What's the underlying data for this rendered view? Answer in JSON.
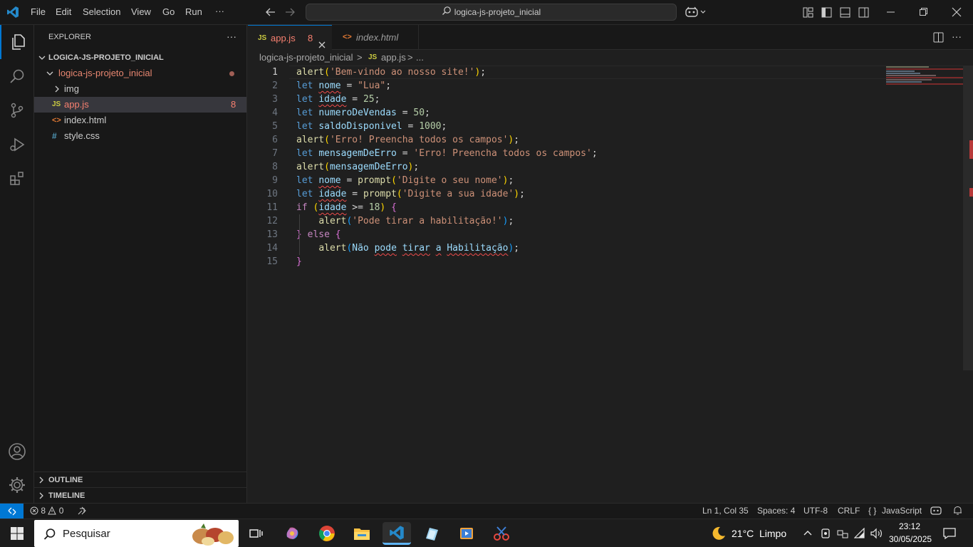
{
  "titlebar": {
    "menu": [
      "File",
      "Edit",
      "Selection",
      "View",
      "Go",
      "Run"
    ],
    "more": "···",
    "search_text": "logica-js-projeto_inicial"
  },
  "sidebar": {
    "header": "EXPLORER",
    "more": "···",
    "root": "LOGICA-JS-PROJETO_INICIAL",
    "folder": "logica-js-projeto_inicial",
    "items": [
      {
        "label": "img",
        "kind": "folder"
      },
      {
        "label": "app.js",
        "kind": "js",
        "badge": "8",
        "selected": true
      },
      {
        "label": "index.html",
        "kind": "html"
      },
      {
        "label": "style.css",
        "kind": "css"
      }
    ],
    "outline": "OUTLINE",
    "timeline": "TIMELINE"
  },
  "tabs": [
    {
      "icon": "JS",
      "label": "app.js",
      "badge": "8",
      "active": true
    },
    {
      "icon": "<>",
      "label": "index.html",
      "active": false
    }
  ],
  "breadcrumb": {
    "folder": "logica-js-projeto_inicial",
    "file_icon": "JS",
    "file": "app.js",
    "sep": ">",
    "tail": "..."
  },
  "editor": {
    "line_numbers": [
      "1",
      "2",
      "3",
      "4",
      "5",
      "6",
      "7",
      "8",
      "9",
      "10",
      "11",
      "12",
      "13",
      "14",
      "15"
    ],
    "current_line": 1
  },
  "statusbar": {
    "errors": "8",
    "warnings": "0",
    "position": "Ln 1, Col 35",
    "spaces": "Spaces: 4",
    "encoding": "UTF-8",
    "eol": "CRLF",
    "language_icon": "{ }",
    "language": "JavaScript"
  },
  "taskbar": {
    "search_placeholder": "Pesquisar",
    "weather_temp": "21°C",
    "weather_text": "Limpo",
    "time": "23:12",
    "date": "30/05/2025"
  },
  "colors": {
    "accent": "#0078d4",
    "error": "#f14c4c",
    "modified_tab": "#e2c08d",
    "js_icon": "#cbcb41"
  }
}
